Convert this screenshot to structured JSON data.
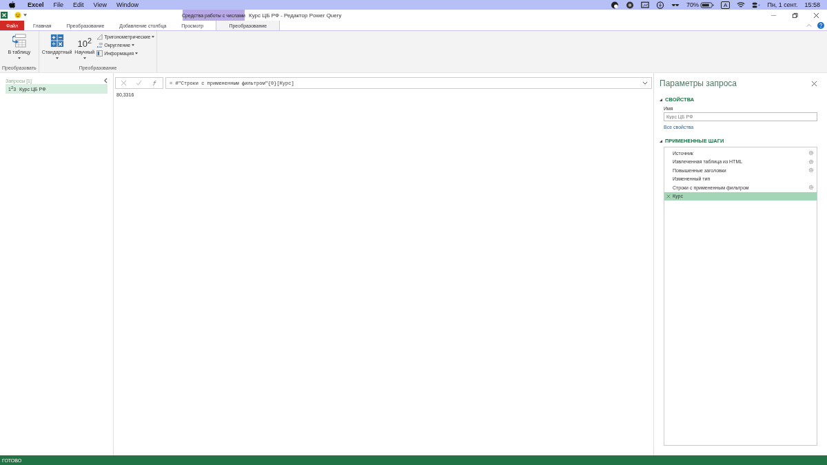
{
  "menubar": {
    "app": "Excel",
    "items": [
      "File",
      "Edit",
      "View",
      "Window"
    ],
    "battery": "70%",
    "keyboard": "A",
    "date": "Пн, 1 сент.",
    "time": "15:58"
  },
  "window": {
    "title": "Курс ЦБ РФ - Редактор Power Query",
    "context_group": "Средства работы с числами"
  },
  "tabs": [
    {
      "label": "Файл",
      "kind": "file",
      "selected": false
    },
    {
      "label": "Главная",
      "kind": "normal",
      "selected": false
    },
    {
      "label": "Преобразование",
      "kind": "normal",
      "selected": false
    },
    {
      "label": "Добавление столбца",
      "kind": "normal",
      "selected": false
    },
    {
      "label": "Просмотр",
      "kind": "normal",
      "selected": false
    },
    {
      "label": "Преобразование",
      "kind": "context",
      "selected": true
    }
  ],
  "ribbon": {
    "groups": [
      {
        "label": "Преобразовать",
        "big": [
          {
            "label": "В таблицу",
            "kind": "table"
          }
        ]
      },
      {
        "label": "Преобразование",
        "big": [
          {
            "label": "Стандартный",
            "kind": "calc"
          },
          {
            "label": "Научный",
            "kind": "power",
            "caption": "10$^{2}$"
          }
        ],
        "small": [
          {
            "label": "Тригонометрические",
            "kind": "trig"
          },
          {
            "label": "Округление",
            "kind": "round"
          },
          {
            "label": "Информация",
            "kind": "info"
          }
        ]
      }
    ]
  },
  "queries": {
    "header": "Запросы [1]",
    "items": [
      {
        "type": "1$^{2}$3",
        "name": "Курс ЦБ РФ",
        "selected": true
      }
    ]
  },
  "formula": {
    "text": "= #\"Строки с примененным фильтром\"{0}[Курс]"
  },
  "result": "80,3316",
  "settings": {
    "title": "Параметры запроса",
    "properties_header": "СВОЙСТВА",
    "name_label": "Имя",
    "name_value": "Курс ЦБ РФ",
    "all_properties": "Все свойства",
    "steps_header": "ПРИМЕНЕННЫЕ ШАГИ",
    "steps": [
      {
        "label": "Источник",
        "gear": true,
        "selected": false
      },
      {
        "label": "Извлеченная таблица из HTML",
        "gear": true,
        "selected": false
      },
      {
        "label": "Повышенные заголовки",
        "gear": true,
        "selected": false
      },
      {
        "label": "Измененный тип",
        "gear": false,
        "selected": false
      },
      {
        "label": "Строки с примененным фильтром",
        "gear": true,
        "selected": false
      },
      {
        "label": "Курс",
        "gear": false,
        "selected": true
      }
    ]
  },
  "status_bar": "ГОТОВО"
}
